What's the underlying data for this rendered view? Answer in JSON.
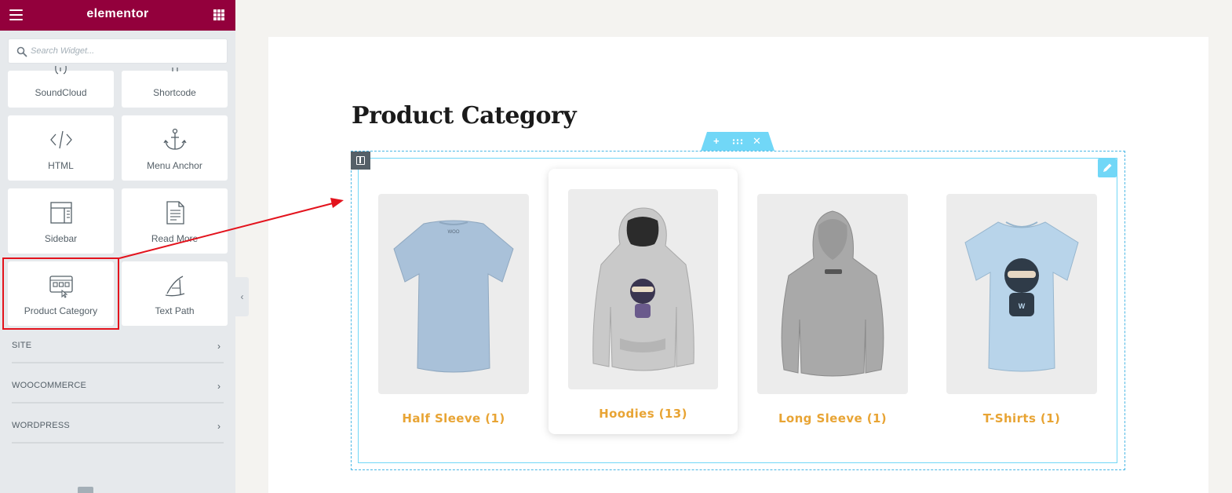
{
  "header": {
    "logo": "elementor"
  },
  "search": {
    "placeholder": "Search Widget..."
  },
  "widgets": [
    {
      "label": "SoundCloud",
      "icon": "soundcloud-icon"
    },
    {
      "label": "Shortcode",
      "icon": "shortcode-icon"
    },
    {
      "label": "HTML",
      "icon": "code-icon"
    },
    {
      "label": "Menu Anchor",
      "icon": "anchor-icon"
    },
    {
      "label": "Sidebar",
      "icon": "sidebar-icon"
    },
    {
      "label": "Read More",
      "icon": "document-icon"
    },
    {
      "label": "Product Category",
      "icon": "product-category-icon"
    },
    {
      "label": "Text Path",
      "icon": "text-path-icon"
    }
  ],
  "categories": [
    {
      "label": "SITE"
    },
    {
      "label": "WOOCOMMERCE"
    },
    {
      "label": "WORDPRESS"
    }
  ],
  "page": {
    "heading": "Product Category"
  },
  "products": [
    {
      "title": "Half Sleeve (1)",
      "image": "tshirt-back-icon"
    },
    {
      "title": "Hoodies (13)",
      "image": "hoodie-front-icon"
    },
    {
      "title": "Long Sleeve (1)",
      "image": "hoodie-back-icon"
    },
    {
      "title": "T-Shirts (1)",
      "image": "tshirt-front-icon"
    }
  ],
  "colors": {
    "brand": "#93003c",
    "accent_title": "#e8a434",
    "editor_outline": "#71d7f7",
    "annotation": "#e3131d"
  }
}
